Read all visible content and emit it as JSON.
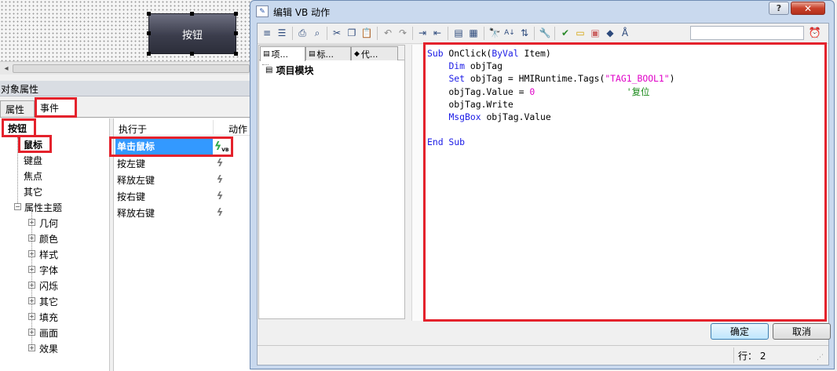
{
  "canvas": {
    "button_label": "按钮"
  },
  "properties_panel": {
    "title": "对象属性",
    "tabs": [
      "属性",
      "事件"
    ],
    "tree": {
      "root": "按钮",
      "items": [
        "鼠标",
        "键盘",
        "焦点",
        "其它"
      ],
      "group": "属性主题",
      "group_items": [
        "几何",
        "颜色",
        "样式",
        "字体",
        "闪烁",
        "其它",
        "填充",
        "画面",
        "效果"
      ]
    },
    "events": {
      "header_col1": "执行于",
      "header_col2": "动作",
      "rows": [
        "单击鼠标",
        "按左键",
        "释放左键",
        "按右键",
        "释放右键"
      ],
      "selected_badge": "VB"
    }
  },
  "dialog": {
    "title": "编辑 VB 动作",
    "help_label": "?",
    "close_label": "✕",
    "nav_tabs": [
      "项...",
      "标...",
      "代..."
    ],
    "nav_item": "项目模块",
    "code_lines": [
      [
        {
          "t": "Sub",
          "c": "kw"
        },
        {
          "t": " OnClick("
        },
        {
          "t": "ByVal",
          "c": "kw"
        },
        {
          "t": " Item)"
        }
      ],
      [
        {
          "t": "    "
        },
        {
          "t": "Dim",
          "c": "kw"
        },
        {
          "t": " objTag"
        }
      ],
      [
        {
          "t": "    "
        },
        {
          "t": "Set",
          "c": "kw"
        },
        {
          "t": " objTag = HMIRuntime.Tags("
        },
        {
          "t": "\"TAG1_BOOL1\"",
          "c": "str"
        },
        {
          "t": ")"
        }
      ],
      [
        {
          "t": "    objTag.Value = "
        },
        {
          "t": "0",
          "c": "num"
        },
        {
          "t": "                 "
        },
        {
          "t": "'复位",
          "c": "cmt"
        }
      ],
      [
        {
          "t": "    objTag.Write"
        }
      ],
      [
        {
          "t": "    "
        },
        {
          "t": "MsgBox",
          "c": "kw"
        },
        {
          "t": " objTag.Value"
        }
      ],
      [
        {
          "t": ""
        }
      ],
      [
        {
          "t": "End Sub",
          "c": "kw"
        }
      ]
    ],
    "ok_label": "确定",
    "cancel_label": "取消",
    "status_line": "行： 2"
  }
}
